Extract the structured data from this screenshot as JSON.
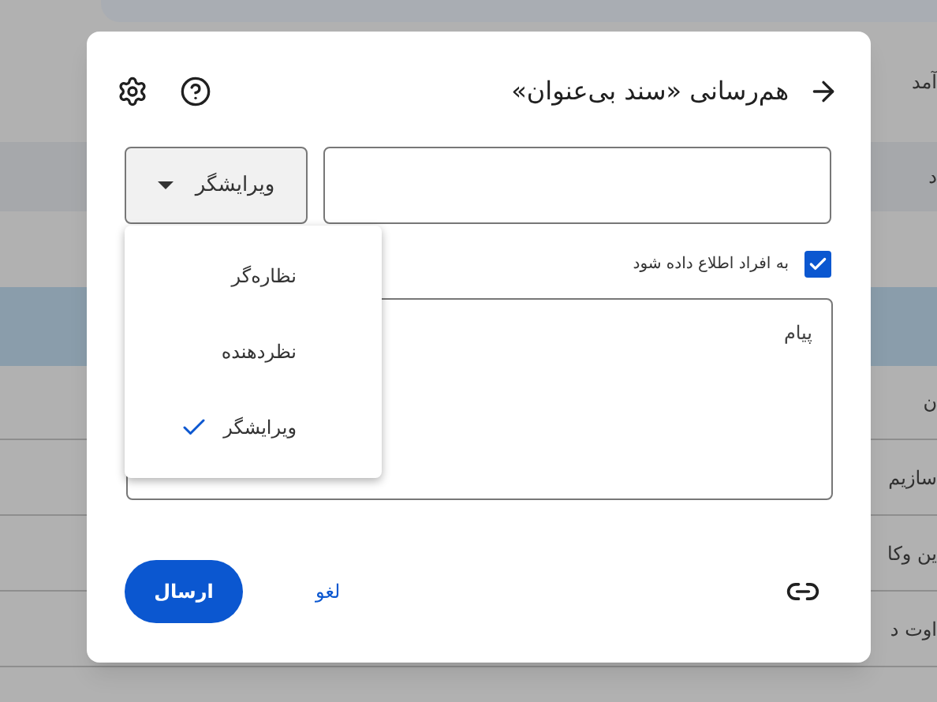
{
  "background": {
    "heading": "آمد",
    "column_header": "د",
    "rows": [
      {
        "selected": false
      },
      {
        "selected": true
      },
      {
        "text": "ن",
        "selected": false
      },
      {
        "text": "سازیم",
        "selected": false
      },
      {
        "text": "ین وکا",
        "selected": false
      },
      {
        "text": "اوت د",
        "selected": false
      }
    ]
  },
  "dialog": {
    "title": "هم‌رسانی «سند بی‌عنوان»",
    "role_button": {
      "label": "ویرایشگر"
    },
    "notify": {
      "label": "به افراد اطلاع داده شود",
      "checked": true
    },
    "message": {
      "placeholder": "پیام"
    },
    "role_menu": [
      {
        "label": "نظاره‌گر",
        "selected": false
      },
      {
        "label": "نظردهنده",
        "selected": false
      },
      {
        "label": "ویرایشگر",
        "selected": true
      }
    ],
    "buttons": {
      "send": "ارسال",
      "cancel": "لغو"
    }
  }
}
